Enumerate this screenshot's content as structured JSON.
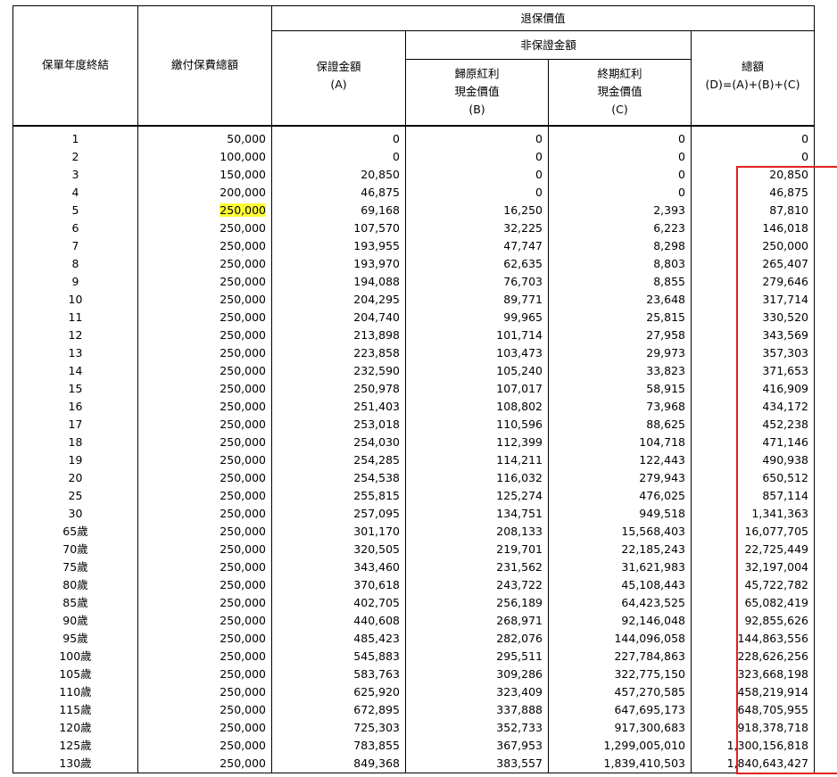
{
  "header": {
    "col_year": "保單年度終結",
    "col_premium": "繳付保費總額",
    "group_surrender": "退保價值",
    "col_guaranteed": [
      "保證金額",
      "(A)"
    ],
    "group_non_guaranteed": "非保證金額",
    "col_reversionary": [
      "歸原紅利",
      "現金價值",
      "(B)"
    ],
    "col_terminal": [
      "終期紅利",
      "現金價值",
      "(C)"
    ],
    "col_total": [
      "總額",
      "(D)=(A)+(B)+(C)"
    ]
  },
  "highlight_colors": {
    "yellow_marker": "#ffff33",
    "red_box": "#e02020"
  },
  "rows": [
    [
      "1",
      "50,000",
      "0",
      "0",
      "0",
      "0"
    ],
    [
      "2",
      "100,000",
      "0",
      "0",
      "0",
      "0"
    ],
    [
      "3",
      "150,000",
      "20,850",
      "0",
      "0",
      "20,850"
    ],
    [
      "4",
      "200,000",
      "46,875",
      "0",
      "0",
      "46,875"
    ],
    [
      "5",
      "250,000",
      "69,168",
      "16,250",
      "2,393",
      "87,810"
    ],
    [
      "6",
      "250,000",
      "107,570",
      "32,225",
      "6,223",
      "146,018"
    ],
    [
      "7",
      "250,000",
      "193,955",
      "47,747",
      "8,298",
      "250,000"
    ],
    [
      "8",
      "250,000",
      "193,970",
      "62,635",
      "8,803",
      "265,407"
    ],
    [
      "9",
      "250,000",
      "194,088",
      "76,703",
      "8,855",
      "279,646"
    ],
    [
      "10",
      "250,000",
      "204,295",
      "89,771",
      "23,648",
      "317,714"
    ],
    [
      "11",
      "250,000",
      "204,740",
      "99,965",
      "25,815",
      "330,520"
    ],
    [
      "12",
      "250,000",
      "213,898",
      "101,714",
      "27,958",
      "343,569"
    ],
    [
      "13",
      "250,000",
      "223,858",
      "103,473",
      "29,973",
      "357,303"
    ],
    [
      "14",
      "250,000",
      "232,590",
      "105,240",
      "33,823",
      "371,653"
    ],
    [
      "15",
      "250,000",
      "250,978",
      "107,017",
      "58,915",
      "416,909"
    ],
    [
      "16",
      "250,000",
      "251,403",
      "108,802",
      "73,968",
      "434,172"
    ],
    [
      "17",
      "250,000",
      "253,018",
      "110,596",
      "88,625",
      "452,238"
    ],
    [
      "18",
      "250,000",
      "254,030",
      "112,399",
      "104,718",
      "471,146"
    ],
    [
      "19",
      "250,000",
      "254,285",
      "114,211",
      "122,443",
      "490,938"
    ],
    [
      "20",
      "250,000",
      "254,538",
      "116,032",
      "279,943",
      "650,512"
    ],
    [
      "25",
      "250,000",
      "255,815",
      "125,274",
      "476,025",
      "857,114"
    ],
    [
      "30",
      "250,000",
      "257,095",
      "134,751",
      "949,518",
      "1,341,363"
    ],
    [
      "65歲",
      "250,000",
      "301,170",
      "208,133",
      "15,568,403",
      "16,077,705"
    ],
    [
      "70歲",
      "250,000",
      "320,505",
      "219,701",
      "22,185,243",
      "22,725,449"
    ],
    [
      "75歲",
      "250,000",
      "343,460",
      "231,562",
      "31,621,983",
      "32,197,004"
    ],
    [
      "80歲",
      "250,000",
      "370,618",
      "243,722",
      "45,108,443",
      "45,722,782"
    ],
    [
      "85歲",
      "250,000",
      "402,705",
      "256,189",
      "64,423,525",
      "65,082,419"
    ],
    [
      "90歲",
      "250,000",
      "440,608",
      "268,971",
      "92,146,048",
      "92,855,626"
    ],
    [
      "95歲",
      "250,000",
      "485,423",
      "282,076",
      "144,096,058",
      "144,863,556"
    ],
    [
      "100歲",
      "250,000",
      "545,883",
      "295,511",
      "227,784,863",
      "228,626,256"
    ],
    [
      "105歲",
      "250,000",
      "583,763",
      "309,286",
      "322,775,150",
      "323,668,198"
    ],
    [
      "110歲",
      "250,000",
      "625,920",
      "323,409",
      "457,270,585",
      "458,219,914"
    ],
    [
      "115歲",
      "250,000",
      "672,895",
      "337,888",
      "647,695,173",
      "648,705,955"
    ],
    [
      "120歲",
      "250,000",
      "725,303",
      "352,733",
      "917,300,683",
      "918,378,718"
    ],
    [
      "125歲",
      "250,000",
      "783,855",
      "367,953",
      "1,299,005,010",
      "1,300,156,818"
    ],
    [
      "130歲",
      "250,000",
      "849,368",
      "383,557",
      "1,839,410,503",
      "1,840,643,427"
    ]
  ]
}
